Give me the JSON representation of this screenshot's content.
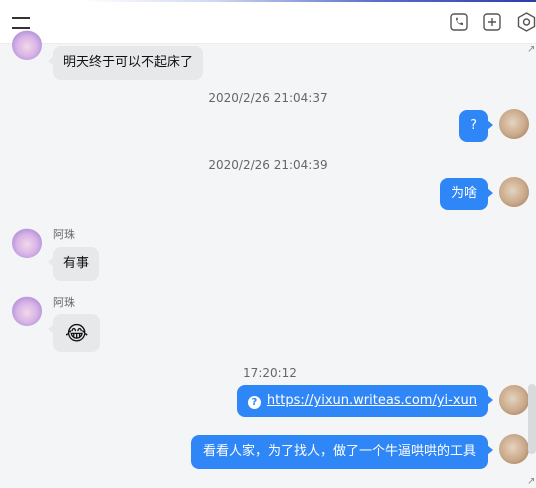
{
  "colors": {
    "accent": "#2f86f6",
    "incoming_bubble": "#e7e8ea"
  },
  "toolbar": {
    "menu_icon": "hamburger-icon",
    "icons": [
      "phone-icon",
      "add-square-icon",
      "settings-hexagon-icon"
    ]
  },
  "messages": {
    "m1": {
      "text": "明天终于可以不起床了"
    },
    "t1": "2020/2/26 21:04:37",
    "m2": {
      "text": "?"
    },
    "t2": "2020/2/26 21:04:39",
    "m3": {
      "text": "为啥"
    },
    "m4": {
      "sender": "阿珠",
      "text": "有事"
    },
    "m5": {
      "sender": "阿珠",
      "emoji": "😂"
    },
    "t3": "17:20:12",
    "m6": {
      "link": "https://yixun.writeas.com/yi-xun"
    },
    "m7": {
      "text": "看看人家，为了找人，做了一个牛逼哄哄的工具"
    }
  }
}
